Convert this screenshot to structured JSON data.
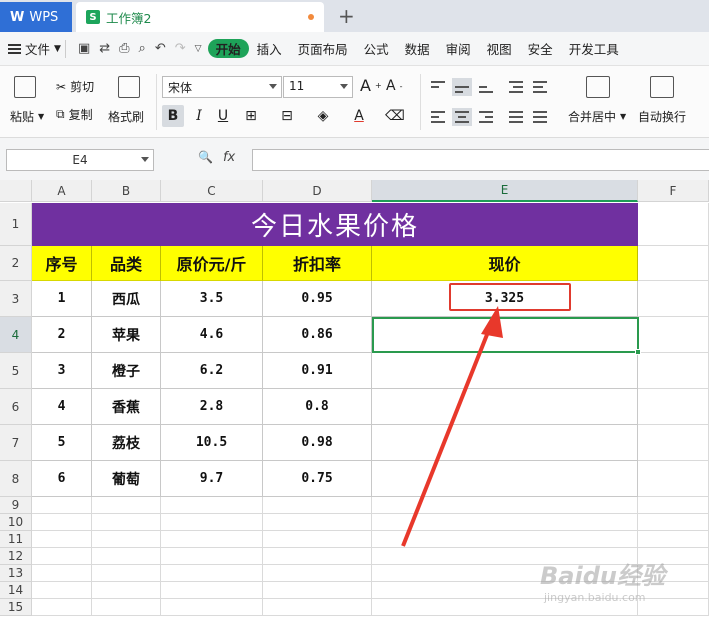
{
  "tabs": {
    "home": "WPS",
    "doc": "工作簿2",
    "new": "+"
  },
  "menu": {
    "file": "文件",
    "items": [
      "开始",
      "插入",
      "页面布局",
      "公式",
      "数据",
      "审阅",
      "视图",
      "安全",
      "开发工具"
    ]
  },
  "ribbon": {
    "paste": "粘贴",
    "cut": "剪切",
    "copy": "复制",
    "format_painter": "格式刷",
    "font_name": "宋体",
    "font_size": "11",
    "merge": "合并居中",
    "wrap": "自动换行",
    "bold": "B",
    "italic": "I",
    "underline": "U"
  },
  "formula_bar": {
    "name_box": "E4",
    "fx": "fx",
    "search": "🔍",
    "formula": ""
  },
  "columns": [
    "A",
    "B",
    "C",
    "D",
    "E",
    "F"
  ],
  "rows": [
    "1",
    "2",
    "3",
    "4",
    "5",
    "6",
    "7",
    "8",
    "9",
    "10",
    "11",
    "12",
    "13",
    "14",
    "15"
  ],
  "sheet": {
    "title": "今日水果价格",
    "headers": [
      "序号",
      "品类",
      "原价元/斤",
      "折扣率",
      "现价"
    ],
    "data": [
      [
        "1",
        "西瓜",
        "3.5",
        "0.95",
        "3.325"
      ],
      [
        "2",
        "苹果",
        "4.6",
        "0.86",
        ""
      ],
      [
        "3",
        "橙子",
        "6.2",
        "0.91",
        ""
      ],
      [
        "4",
        "香蕉",
        "2.8",
        "0.8",
        ""
      ],
      [
        "5",
        "荔枝",
        "10.5",
        "0.98",
        ""
      ],
      [
        "6",
        "葡萄",
        "9.7",
        "0.75",
        ""
      ]
    ]
  },
  "colors": {
    "title_bg": "#7030a0",
    "header_bg": "#ffff00",
    "highlight": "#e03a2e",
    "selection": "#2a9a4e",
    "wps_blue": "#2f6fd6",
    "start_green": "#1ea359"
  },
  "watermark": {
    "text": "Baidu经验",
    "sub": "jingyan.baidu.com"
  }
}
